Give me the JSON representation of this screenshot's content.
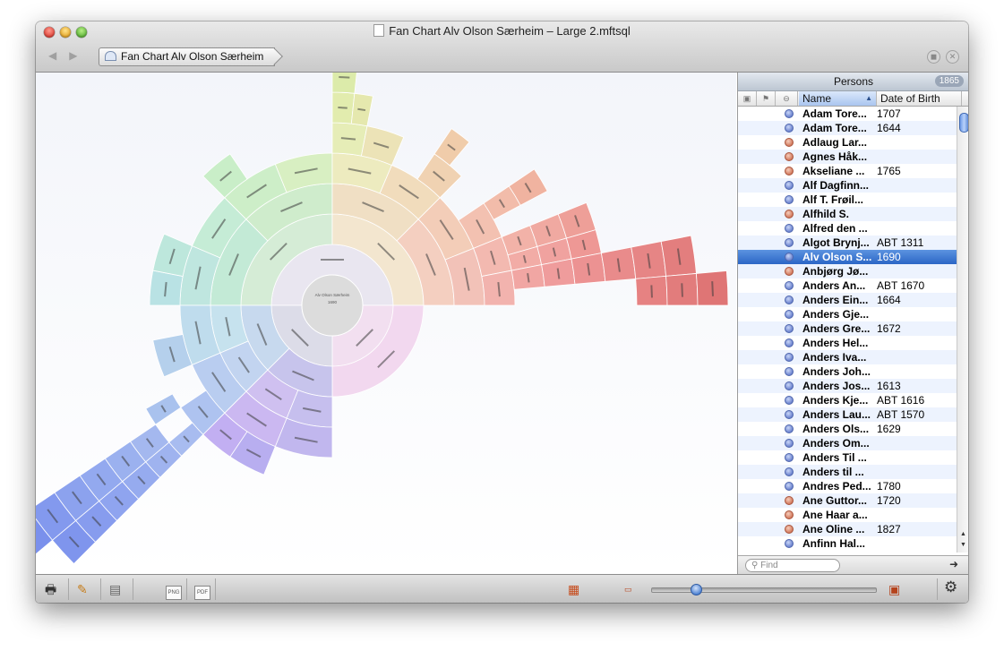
{
  "window": {
    "title": "Fan Chart Alv Olson Særheim – Large 2.mftsql",
    "breadcrumb": "Fan Chart Alv Olson Særheim",
    "nav_back": "◀",
    "nav_forward": "▶"
  },
  "fan_chart": {
    "center_name": "Alv Olson Særheim",
    "center_year": "1690"
  },
  "sidebar": {
    "title": "Persons",
    "count": "1865",
    "columns": {
      "name": "Name",
      "date": "Date of Birth"
    },
    "find_placeholder": "Find",
    "persons": [
      {
        "name": "Adam Tore...",
        "date": "1707",
        "gender": "m"
      },
      {
        "name": "Adam Tore...",
        "date": "1644",
        "gender": "m"
      },
      {
        "name": "Adlaug Lar...",
        "date": "",
        "gender": "f"
      },
      {
        "name": "Agnes Håk...",
        "date": "",
        "gender": "f"
      },
      {
        "name": "Akseliane ...",
        "date": "1765",
        "gender": "f"
      },
      {
        "name": "Alf Dagfinn...",
        "date": "",
        "gender": "m"
      },
      {
        "name": "Alf T. Frøil...",
        "date": "",
        "gender": "m"
      },
      {
        "name": "Alfhild S.",
        "date": "",
        "gender": "f"
      },
      {
        "name": "Alfred den ...",
        "date": "",
        "gender": "m"
      },
      {
        "name": "Algot Brynj...",
        "date": "ABT 1311",
        "gender": "m"
      },
      {
        "name": "Alv Olson S...",
        "date": "1690",
        "gender": "m",
        "selected": true
      },
      {
        "name": "Anbjørg Jø...",
        "date": "",
        "gender": "f"
      },
      {
        "name": "Anders An...",
        "date": "ABT 1670",
        "gender": "m"
      },
      {
        "name": "Anders Ein...",
        "date": "1664",
        "gender": "m"
      },
      {
        "name": "Anders Gje...",
        "date": "",
        "gender": "m"
      },
      {
        "name": "Anders Gre...",
        "date": "1672",
        "gender": "m"
      },
      {
        "name": "Anders Hel...",
        "date": "",
        "gender": "m"
      },
      {
        "name": "Anders Iva...",
        "date": "",
        "gender": "m"
      },
      {
        "name": "Anders Joh...",
        "date": "",
        "gender": "m"
      },
      {
        "name": "Anders Jos...",
        "date": "1613",
        "gender": "m"
      },
      {
        "name": "Anders Kje...",
        "date": "ABT 1616",
        "gender": "m"
      },
      {
        "name": "Anders Lau...",
        "date": "ABT 1570",
        "gender": "m"
      },
      {
        "name": "Anders Ols...",
        "date": "1629",
        "gender": "m"
      },
      {
        "name": "Anders Om...",
        "date": "",
        "gender": "m"
      },
      {
        "name": "Anders Til ...",
        "date": "",
        "gender": "m"
      },
      {
        "name": "Anders til ...",
        "date": "",
        "gender": "m"
      },
      {
        "name": "Andres Ped...",
        "date": "1780",
        "gender": "m"
      },
      {
        "name": "Ane Guttor...",
        "date": "1720",
        "gender": "f"
      },
      {
        "name": "Ane Haar a...",
        "date": "",
        "gender": "f"
      },
      {
        "name": "Ane Oline ...",
        "date": "1827",
        "gender": "f"
      },
      {
        "name": "Anfinn Hal...",
        "date": "",
        "gender": "m"
      }
    ]
  },
  "bottombar": {
    "png": "PNG",
    "pdf": "PDF"
  },
  "zoom_fraction": 0.18
}
